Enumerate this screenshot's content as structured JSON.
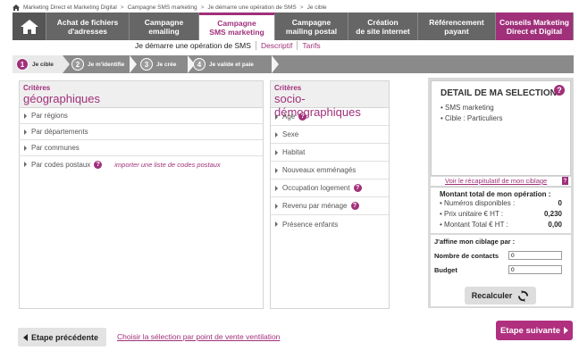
{
  "breadcrumb": [
    "Marketing Direct et Marketing Digital",
    "Campagne SMS marketing",
    "Je démarre une opération de SMS",
    "Je cible"
  ],
  "breadcrumb_sep": ">",
  "nav": {
    "tabs": [
      {
        "label": "Achat de fichiers\nd'adresses"
      },
      {
        "label": "Campagne\nemailing"
      },
      {
        "label": "Campagne\nSMS marketing",
        "active": true
      },
      {
        "label": "Campagne\nmailing postal"
      },
      {
        "label": "Création\nde site internet"
      },
      {
        "label": "Référencement\npayant"
      },
      {
        "label": "Conseils Marketing\nDirect et Digital"
      }
    ]
  },
  "subnav": {
    "current": "Je démarre une opération de SMS",
    "links": [
      "Descriptif",
      "Tarifs"
    ]
  },
  "steps": [
    {
      "num": "1",
      "label": "Je cible",
      "active": true
    },
    {
      "num": "2",
      "label": "Je m'identifie"
    },
    {
      "num": "3",
      "label": "Je crée"
    },
    {
      "num": "4",
      "label": "Je valide et paie"
    }
  ],
  "geo": {
    "small": "Critères",
    "big": "géographiques",
    "items": [
      "Par régions",
      "Par départements",
      "Par communes",
      "Par codes postaux"
    ],
    "import_link": "importer une liste de codes postaux"
  },
  "socio": {
    "small": "Critères",
    "big": "socio-démographiques",
    "items": [
      "Age",
      "Sexe",
      "Habitat",
      "Nouveaux emménagés",
      "Occupation logement",
      "Revenu par ménage",
      "Présence enfants"
    ]
  },
  "detail": {
    "title": "DETAIL DE MA SELECTION",
    "lines": [
      "SMS marketing",
      "Cible : Particuliers"
    ],
    "recap_link": "Voir le récapitulatif de mon ciblage"
  },
  "montant": {
    "title": "Montant total de mon opération :",
    "rows": [
      {
        "label": "Numéros disponibles :",
        "value": "0"
      },
      {
        "label": "Prix unitaire € HT :",
        "value": "0,230"
      },
      {
        "label": "Montant Total € HT :",
        "value": "0,00"
      }
    ]
  },
  "affine": {
    "title": "J'affine mon ciblage par :",
    "contacts_label": "Nombre de contacts",
    "contacts_value": "0",
    "budget_label": "Budget",
    "budget_value": "0",
    "button": "Recalculer"
  },
  "bottom": {
    "prev": "Etape précédente",
    "choisir": "Choisir la sélection par point de vente",
    "ventilation": "ventilation",
    "next": "Etape suivante"
  },
  "colors": {
    "accent": "#a0307a",
    "nav": "#666666"
  }
}
